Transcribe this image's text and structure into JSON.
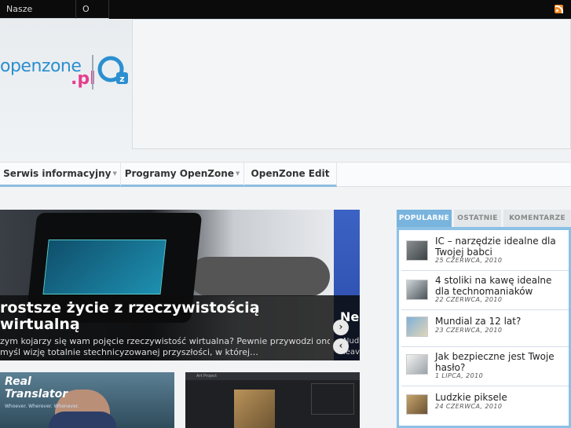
{
  "topbar": {
    "items": [
      {
        "label": "Nasze programy"
      },
      {
        "label": "O nas"
      }
    ],
    "rss_icon": "rss-icon"
  },
  "logo": {
    "text": "openzone",
    "domain": ".pl",
    "badge": "OZ",
    "colors": {
      "blue": "#2b8fd0",
      "pink": "#e63f8f"
    }
  },
  "nav": {
    "tabs": [
      {
        "label": "Serwis informacyjny"
      },
      {
        "label": "Programy OpenZone"
      },
      {
        "label": "OpenZone Edit"
      }
    ]
  },
  "slider": {
    "title_line1": "rostsze życie z rzeczywistością",
    "title_line2": "wirtualną",
    "excerpt_line1": "zym kojarzy się wam pojęcie rzeczywistość wirtualna? Pewnie przywodzi ono",
    "excerpt_line2": "myśl wizję totalnie stechnicyzowanej przyszłości, w której…",
    "side_title": "Ne",
    "side_line1": "Nud",
    "side_line2": "leav",
    "next_label": "›",
    "prev_label": "‹"
  },
  "thumbs": [
    {
      "title_line1": "Real",
      "title_line2": "Translator",
      "sub": "Whoever. Wherever. Whenever."
    },
    {
      "header": "Art Project"
    }
  ],
  "sidebar": {
    "tabs": [
      {
        "label": "POPULARNE",
        "active": true
      },
      {
        "label": "OSTATNIE",
        "active": false
      },
      {
        "label": "KOMENTARZE",
        "active": false
      }
    ],
    "items": [
      {
        "title": "IC – narzędzie idealne dla Twojej babci",
        "date": "25 CZERWCA, 2010"
      },
      {
        "title": "4 stoliki na kawę idealne dla technomaniaków",
        "date": "22 CZERWCA, 2010"
      },
      {
        "title": "Mundial za 12 lat?",
        "date": "23 CZERWCA, 2010"
      },
      {
        "title": "Jak bezpieczne jest Twoje hasło?",
        "date": "1 LIPCA, 2010"
      },
      {
        "title": "Ludzkie piksele",
        "date": "24 CZERWCA, 2010"
      }
    ],
    "accent": "#79b4de"
  }
}
